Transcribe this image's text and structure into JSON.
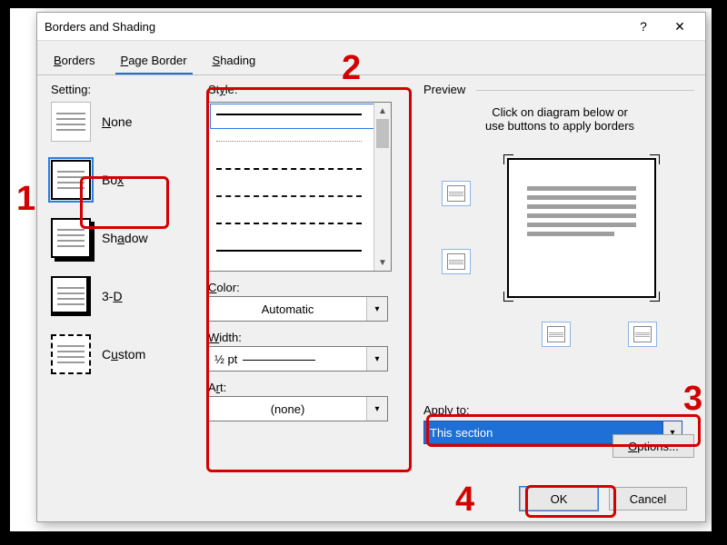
{
  "dialog": {
    "title": "Borders and Shading",
    "help": "?",
    "close": "✕"
  },
  "tabs": {
    "borders": "Borders",
    "page_border": "Page Border",
    "shading": "Shading"
  },
  "setting": {
    "label": "Setting:",
    "none": "None",
    "box": "Box",
    "shadow": "Shadow",
    "threed": "3-D",
    "custom": "Custom"
  },
  "style": {
    "label": "Style:",
    "color_label": "Color:",
    "color_value": "Automatic",
    "width_label": "Width:",
    "width_value": "½ pt",
    "art_label": "Art:",
    "art_value": "(none)"
  },
  "preview": {
    "label": "Preview",
    "hint1": "Click on diagram below or",
    "hint2": "use buttons to apply borders",
    "apply_label": "Apply to:",
    "apply_value": "This section",
    "options": "Options..."
  },
  "footer": {
    "ok": "OK",
    "cancel": "Cancel"
  },
  "annotations": {
    "n1": "1",
    "n2": "2",
    "n3": "3",
    "n4": "4"
  }
}
